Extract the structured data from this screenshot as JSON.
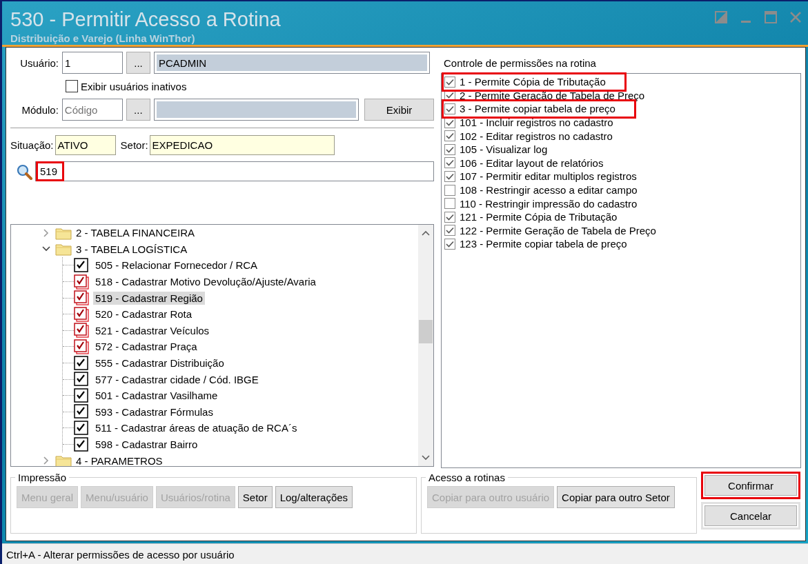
{
  "window": {
    "title": "530 - Permitir Acesso a Rotina",
    "subtitle": "Distribuição e Varejo (Linha WinThor)"
  },
  "form": {
    "user": {
      "label": "Usuário:",
      "code": "1",
      "browse": "...",
      "name": "PCADMIN"
    },
    "inactive": {
      "label": "Exibir usuários inativos",
      "checked": false
    },
    "module": {
      "label": "Módulo:",
      "placeholder": "Código",
      "browse": "...",
      "show_button": "Exibir"
    },
    "situation": {
      "label": "Situação:",
      "value": "ATIVO"
    },
    "sector": {
      "label": "Setor:",
      "value": "EXPEDICAO"
    },
    "search": {
      "value": "519",
      "highlighted": true
    }
  },
  "tree": {
    "items": [
      {
        "kind": "folder",
        "label": "2 - TABELA FINANCEIRA",
        "expanded": false
      },
      {
        "kind": "folder",
        "label": "3 - TABELA LOGÍSTICA",
        "expanded": true,
        "children": [
          {
            "kind": "routine",
            "label": "505 - Relacionar Fornecedor / RCA",
            "checked": true,
            "modified": false,
            "selected": false
          },
          {
            "kind": "routine",
            "label": "518 - Cadastrar Motivo Devolução/Ajuste/Avaria",
            "checked": true,
            "modified": true,
            "selected": false
          },
          {
            "kind": "routine",
            "label": "519 - Cadastrar Região",
            "checked": true,
            "modified": true,
            "selected": true
          },
          {
            "kind": "routine",
            "label": "520 - Cadastrar Rota",
            "checked": true,
            "modified": true,
            "selected": false
          },
          {
            "kind": "routine",
            "label": "521 - Cadastrar Veículos",
            "checked": true,
            "modified": true,
            "selected": false
          },
          {
            "kind": "routine",
            "label": "572 - Cadastrar Praça",
            "checked": true,
            "modified": true,
            "selected": false
          },
          {
            "kind": "routine",
            "label": "555 - Cadastrar Distribuição",
            "checked": true,
            "modified": false,
            "selected": false
          },
          {
            "kind": "routine",
            "label": "577 - Cadastrar cidade / Cód. IBGE",
            "checked": true,
            "modified": false,
            "selected": false
          },
          {
            "kind": "routine",
            "label": "501 - Cadastrar Vasilhame",
            "checked": true,
            "modified": false,
            "selected": false
          },
          {
            "kind": "routine",
            "label": "593 - Cadastrar Fórmulas",
            "checked": true,
            "modified": false,
            "selected": false
          },
          {
            "kind": "routine",
            "label": "511 - Cadastrar áreas de atuação de RCA´s",
            "checked": true,
            "modified": false,
            "selected": false
          },
          {
            "kind": "routine",
            "label": "598 - Cadastrar Bairro",
            "checked": true,
            "modified": false,
            "selected": false
          }
        ]
      },
      {
        "kind": "folder",
        "label": "4 - PARAMETROS",
        "expanded": false
      }
    ]
  },
  "permissions": {
    "title": "Controle de permissões na rotina",
    "items": [
      {
        "label": "1 - Permite Cópia de Tributação",
        "checked": true,
        "highlighted": true
      },
      {
        "label": "2 - Permite Geração de Tabela de Preço",
        "checked": true,
        "highlighted": false
      },
      {
        "label": "3 - Permite copiar tabela de preço",
        "checked": true,
        "highlighted": true
      },
      {
        "label": "101 - Incluir registros no cadastro",
        "checked": true,
        "highlighted": false
      },
      {
        "label": "102 - Editar registros no cadastro",
        "checked": true,
        "highlighted": false
      },
      {
        "label": "105 - Visualizar log",
        "checked": true,
        "highlighted": false
      },
      {
        "label": "106 - Editar layout de relatórios",
        "checked": true,
        "highlighted": false
      },
      {
        "label": "107 - Permitir editar multiplos registros",
        "checked": true,
        "highlighted": false
      },
      {
        "label": "108 - Restringir acesso a editar campo",
        "checked": false,
        "highlighted": false
      },
      {
        "label": "110 - Restringir impressão do cadastro",
        "checked": false,
        "highlighted": false
      },
      {
        "label": "121 - Permite Cópia de Tributação",
        "checked": true,
        "highlighted": false
      },
      {
        "label": "122 - Permite Geração de Tabela de Preço",
        "checked": true,
        "highlighted": false
      },
      {
        "label": "123 - Permite copiar tabela de preço",
        "checked": true,
        "highlighted": false
      }
    ]
  },
  "printing": {
    "title": "Impressão",
    "buttons": [
      {
        "label": "Menu geral",
        "disabled": true
      },
      {
        "label": "Menu/usuário",
        "disabled": true
      },
      {
        "label": "Usuários/rotina",
        "disabled": true
      },
      {
        "label": "Setor",
        "disabled": false
      },
      {
        "label": "Log/alterações",
        "disabled": false
      }
    ]
  },
  "access": {
    "title": "Acesso a rotinas",
    "buttons": [
      {
        "label": "Copiar para outro usuário",
        "disabled": true
      },
      {
        "label": "Copiar para outro Setor",
        "disabled": false
      }
    ]
  },
  "actions": [
    {
      "label": "Confirmar",
      "highlighted": true
    },
    {
      "label": "Cancelar",
      "highlighted": false
    }
  ],
  "status_bar": "Ctrl+A - Alterar permissões de acesso por usuário"
}
